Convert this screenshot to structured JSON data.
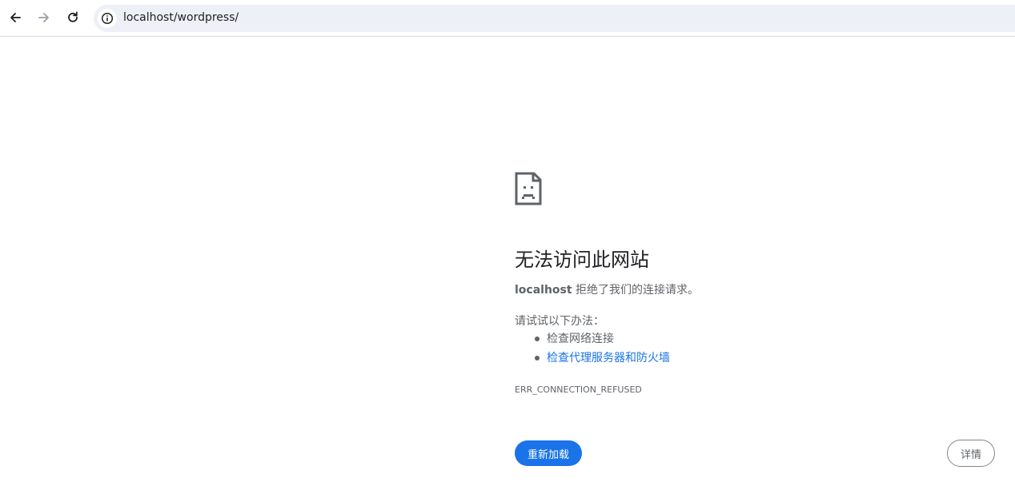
{
  "toolbar": {
    "back_icon": "arrow-left-icon",
    "forward_icon": "arrow-right-icon",
    "reload_icon": "reload-icon",
    "site_info_icon": "info-icon",
    "url": "localhost/wordpress/"
  },
  "error_page": {
    "icon": "sad-page-icon",
    "title": "无法访问此网站",
    "host": "localhost",
    "description": " 拒绝了我们的连接请求。",
    "suggestions_intro": "请试试以下办法：",
    "suggestions": [
      {
        "label": "检查网络连接",
        "is_link": false
      },
      {
        "label": "检查代理服务器和防火墙",
        "is_link": true
      }
    ],
    "error_code": "ERR_CONNECTION_REFUSED",
    "reload_label": "重新加载",
    "details_label": "详情"
  },
  "colors": {
    "accent": "#1a73e8",
    "omnibox_bg": "#edf0f7",
    "secondary_text": "#5f6368"
  }
}
